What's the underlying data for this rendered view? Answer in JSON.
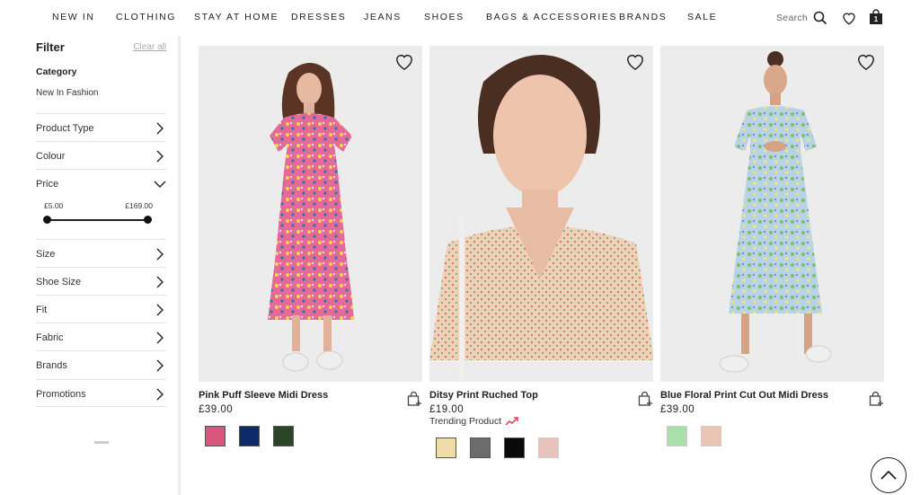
{
  "nav": {
    "items": [
      "NEW IN",
      "CLOTHING",
      "STAY AT HOME",
      "DRESSES",
      "JEANS",
      "SHOES",
      "BAGS & ACCESSORIES",
      "BRANDS",
      "SALE"
    ],
    "search_label": "Search",
    "bag_count": "1"
  },
  "sidebar": {
    "title": "Filter",
    "clear_all": "Clear all",
    "category_title": "Category",
    "category_value": "New In Fashion",
    "filters": [
      "Product Type",
      "Colour",
      "Price",
      "Size",
      "Shoe Size",
      "Fit",
      "Fabric",
      "Brands",
      "Promotions"
    ],
    "price": {
      "min_label": "£5.00",
      "max_label": "£169.00"
    }
  },
  "products": [
    {
      "name": "Pink Puff Sleeve Midi Dress",
      "price": "£39.00",
      "trending": "",
      "swatches": [
        "#d9577f",
        "#0e2a6b",
        "#2c4428"
      ]
    },
    {
      "name": "Ditsy Print Ruched Top",
      "price": "£19.00",
      "trending": "Trending Product",
      "swatches": [
        "#f0dcaa",
        "#6c6c6c",
        "#0a0a0a",
        "#e8c3bb"
      ]
    },
    {
      "name": "Blue Floral Print Cut Out Midi Dress",
      "price": "£39.00",
      "trending": "",
      "swatches": [
        "#a9dfaa",
        "#eac5b3"
      ]
    }
  ],
  "colors": {
    "trend_accent": "#e23c5b",
    "image_bg": "#ececec"
  }
}
